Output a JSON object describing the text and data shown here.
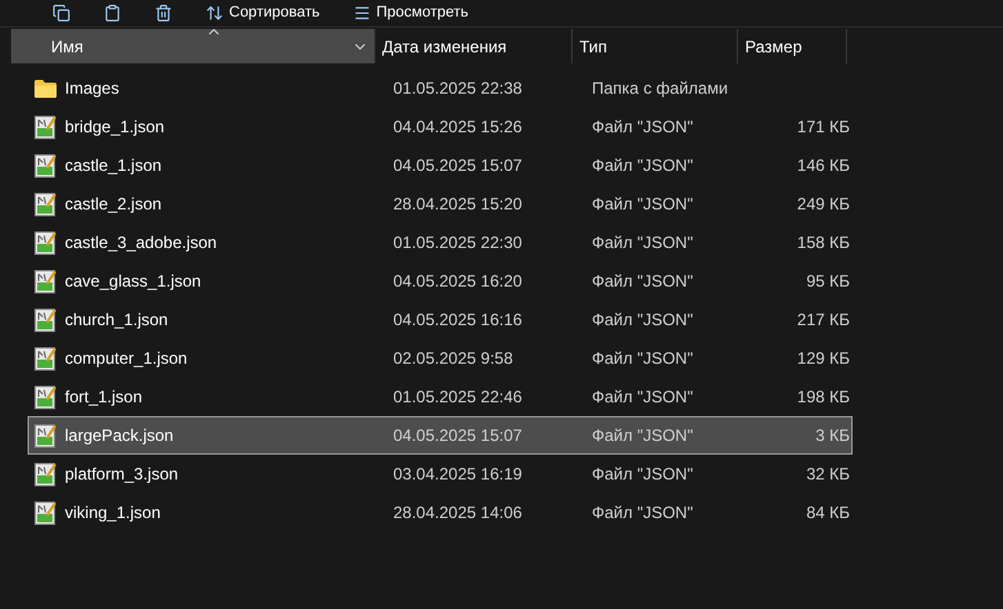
{
  "toolbar": {
    "buttons": [
      {
        "kind": "copy"
      },
      {
        "kind": "paste"
      },
      {
        "kind": "delete"
      },
      {
        "kind": "sort",
        "label": "Сортировать"
      },
      {
        "kind": "view",
        "label": "Просмотреть"
      }
    ]
  },
  "table": {
    "columns": [
      {
        "label": "Имя",
        "sorted": true
      },
      {
        "label": "Дата изменения",
        "sorted": false
      },
      {
        "label": "Тип",
        "sorted": false
      },
      {
        "label": "Размер",
        "sorted": false
      }
    ],
    "rows": [
      {
        "kind": "folder",
        "name": "Images",
        "date": "01.05.2025 22:38",
        "type": "Папка с файлами",
        "size": "",
        "selected": false
      },
      {
        "kind": "file",
        "name": "bridge_1.json",
        "date": "04.04.2025 15:26",
        "type": "Файл \"JSON\"",
        "size": "171 КБ",
        "selected": false
      },
      {
        "kind": "file",
        "name": "castle_1.json",
        "date": "04.05.2025 15:07",
        "type": "Файл \"JSON\"",
        "size": "146 КБ",
        "selected": false
      },
      {
        "kind": "file",
        "name": "castle_2.json",
        "date": "28.04.2025 15:20",
        "type": "Файл \"JSON\"",
        "size": "249 КБ",
        "selected": false
      },
      {
        "kind": "file",
        "name": "castle_3_adobe.json",
        "date": "01.05.2025 22:30",
        "type": "Файл \"JSON\"",
        "size": "158 КБ",
        "selected": false
      },
      {
        "kind": "file",
        "name": "cave_glass_1.json",
        "date": "04.05.2025 16:20",
        "type": "Файл \"JSON\"",
        "size": "95 КБ",
        "selected": false
      },
      {
        "kind": "file",
        "name": "church_1.json",
        "date": "04.05.2025 16:16",
        "type": "Файл \"JSON\"",
        "size": "217 КБ",
        "selected": false
      },
      {
        "kind": "file",
        "name": "computer_1.json",
        "date": "02.05.2025 9:58",
        "type": "Файл \"JSON\"",
        "size": "129 КБ",
        "selected": false
      },
      {
        "kind": "file",
        "name": "fort_1.json",
        "date": "01.05.2025 22:46",
        "type": "Файл \"JSON\"",
        "size": "198 КБ",
        "selected": false
      },
      {
        "kind": "file",
        "name": "largePack.json",
        "date": "04.05.2025 15:07",
        "type": "Файл \"JSON\"",
        "size": "3 КБ",
        "selected": true
      },
      {
        "kind": "file",
        "name": "platform_3.json",
        "date": "03.04.2025 16:19",
        "type": "Файл \"JSON\"",
        "size": "32 КБ",
        "selected": false
      },
      {
        "kind": "file",
        "name": "viking_1.json",
        "date": "28.04.2025 14:06",
        "type": "Файл \"JSON\"",
        "size": "84 КБ",
        "selected": false
      }
    ]
  }
}
